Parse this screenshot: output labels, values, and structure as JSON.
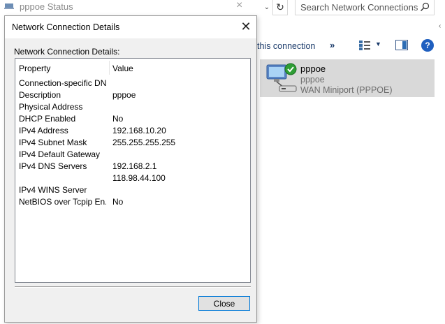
{
  "status_window": {
    "title": "pppoe Status",
    "close": "×"
  },
  "nav": {
    "dropdown": "⌄",
    "refresh": "↻"
  },
  "search": {
    "placeholder": "Search Network Connections"
  },
  "scroll_chevron": "‹",
  "commandbar": {
    "rename_label": "this connection",
    "more_label": "»",
    "view_dropdown": "▼",
    "help": "?"
  },
  "connection": {
    "name": "pppoe",
    "subtitle": "pppoe",
    "device": "WAN Miniport (PPPOE)"
  },
  "dialog": {
    "title": "Network Connection Details",
    "close": "✕",
    "caption": "Network Connection Details:",
    "columns": {
      "property": "Property",
      "value": "Value"
    },
    "rows": [
      {
        "property": "Connection-specific DN...",
        "value": ""
      },
      {
        "property": "Description",
        "value": "pppoe"
      },
      {
        "property": "Physical Address",
        "value": ""
      },
      {
        "property": "DHCP Enabled",
        "value": "No"
      },
      {
        "property": "IPv4 Address",
        "value": "192.168.10.20"
      },
      {
        "property": "IPv4 Subnet Mask",
        "value": "255.255.255.255"
      },
      {
        "property": "IPv4 Default Gateway",
        "value": ""
      },
      {
        "property": "IPv4 DNS Servers",
        "value": "192.168.2.1"
      },
      {
        "property": "",
        "value": "118.98.44.100"
      },
      {
        "property": "IPv4 WINS Server",
        "value": ""
      },
      {
        "property": "NetBIOS over Tcpip En...",
        "value": "No"
      }
    ],
    "close_button": "Close"
  }
}
